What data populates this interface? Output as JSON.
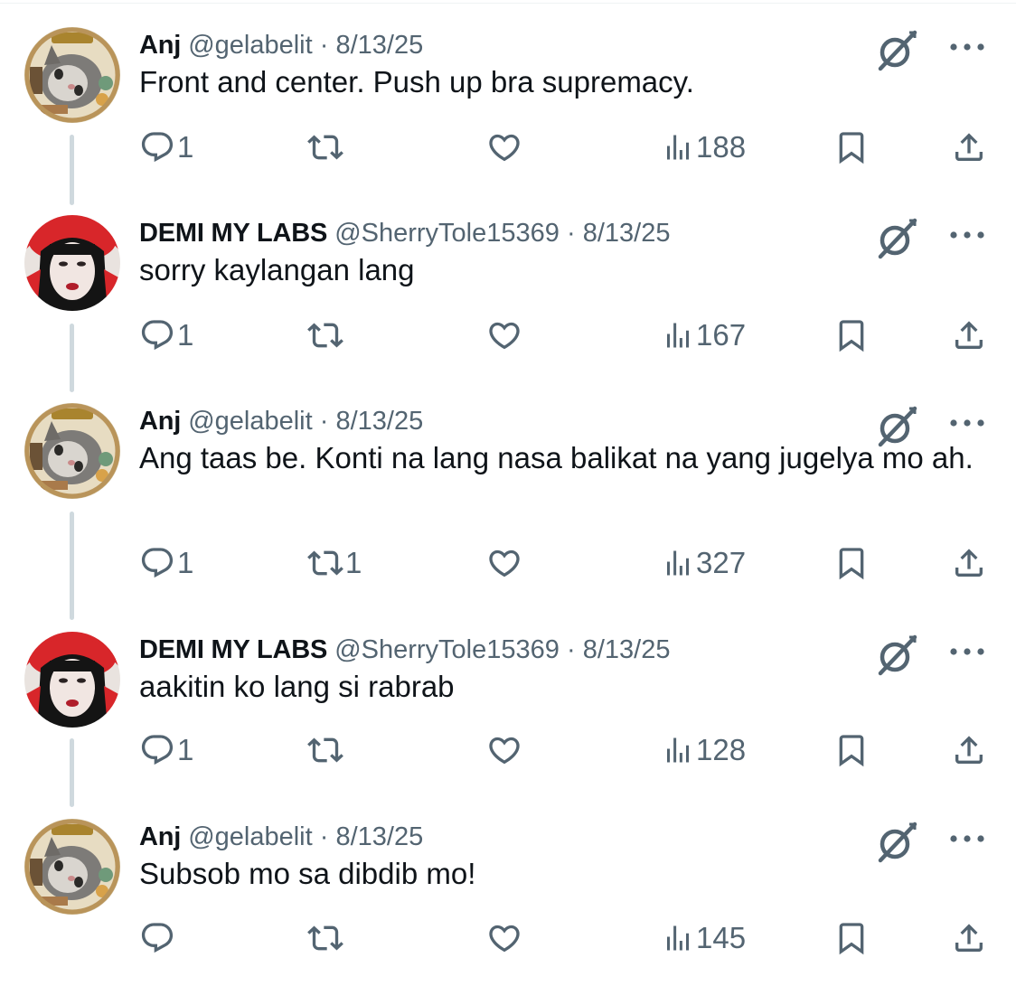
{
  "replies": [
    {
      "avatar": "cat-avatar",
      "name": "Anj",
      "handle": "@gelabelit",
      "separator": "·",
      "date": "8/13/25",
      "text": "Front and center. Push up bra supremacy.",
      "reply_count": "1",
      "retweet_count": "",
      "views": "188"
    },
    {
      "avatar": "red-hat-woman-avatar",
      "name": "DEMI MY LABS",
      "handle": "@SherryTole15369",
      "separator": "·",
      "date": "8/13/25",
      "text": "sorry kaylangan lang",
      "reply_count": "1",
      "retweet_count": "",
      "views": "167"
    },
    {
      "avatar": "cat-avatar",
      "name": "Anj",
      "handle": "@gelabelit",
      "separator": "·",
      "date": "8/13/25",
      "text": "Ang taas be. Konti na lang nasa balikat na yang jugelya mo ah.",
      "reply_count": "1",
      "retweet_count": "1",
      "views": "327"
    },
    {
      "avatar": "red-hat-woman-avatar",
      "name": "DEMI MY LABS",
      "handle": "@SherryTole15369",
      "separator": "·",
      "date": "8/13/25",
      "text": "aakitin ko lang si rabrab",
      "reply_count": "1",
      "retweet_count": "",
      "views": "128"
    },
    {
      "avatar": "cat-avatar",
      "name": "Anj",
      "handle": "@gelabelit",
      "separator": "·",
      "date": "8/13/25",
      "text": "Subsob mo sa dibdib mo!",
      "reply_count": "",
      "retweet_count": "",
      "views": "145"
    }
  ],
  "icons": {
    "reply": "reply-icon",
    "retweet": "retweet-icon",
    "like": "heart-icon",
    "views": "views-chart-icon",
    "bookmark": "bookmark-icon",
    "share": "share-icon",
    "grok": "grok-icon",
    "more": "more-dots-icon"
  },
  "colors": {
    "text_primary": "#0f1419",
    "text_secondary": "#536471",
    "thread_line": "#cfd9de",
    "background": "#ffffff"
  }
}
